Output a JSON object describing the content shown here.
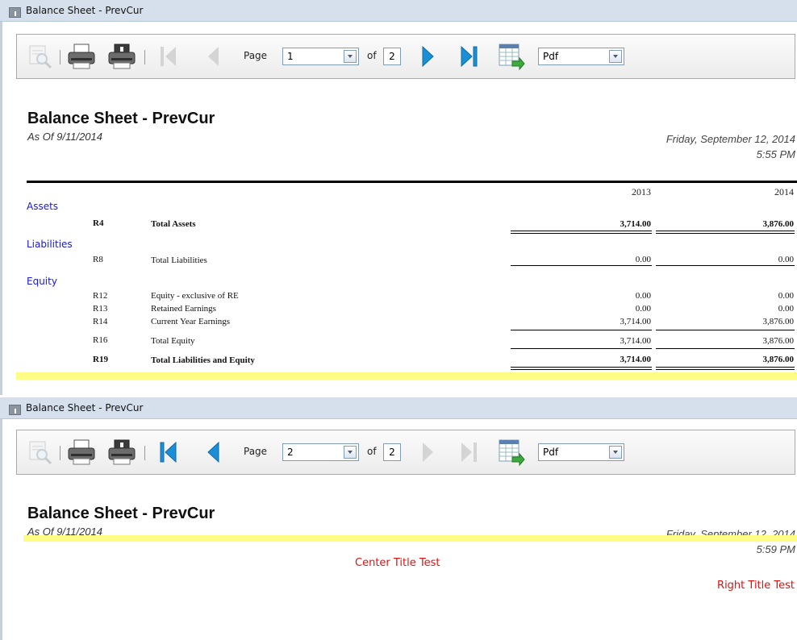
{
  "viewer1": {
    "window_title": "Balance Sheet - PrevCur",
    "toolbar": {
      "page_label": "Page",
      "page_value": "1",
      "of_label": "of",
      "total_pages": "2",
      "format_value": "Pdf"
    },
    "report": {
      "title": "Balance Sheet - PrevCur",
      "as_of": "As Of 9/11/2014",
      "date": "Friday, September 12, 2014",
      "time": "5:55 PM",
      "year_headers": [
        "2013",
        "2014"
      ],
      "sections": {
        "assets": "Assets",
        "liabilities": "Liabilities",
        "equity": "Equity"
      },
      "rows": [
        {
          "code": "R4",
          "label": "Total Assets",
          "v2013": "3,714.00",
          "v2014": "3,876.00",
          "bold": true
        },
        {
          "code": "R8",
          "label": "Total Liabilities",
          "v2013": "0.00",
          "v2014": "0.00",
          "bold": false
        },
        {
          "code": "R12",
          "label": "Equity - exclusive of RE",
          "v2013": "0.00",
          "v2014": "0.00",
          "bold": false
        },
        {
          "code": "R13",
          "label": "Retained Earnings",
          "v2013": "0.00",
          "v2014": "0.00",
          "bold": false
        },
        {
          "code": "R14",
          "label": "Current Year Earnings",
          "v2013": "3,714.00",
          "v2014": "3,876.00",
          "bold": false
        },
        {
          "code": "R16",
          "label": "Total Equity",
          "v2013": "3,714.00",
          "v2014": "3,876.00",
          "bold": false
        },
        {
          "code": "R19",
          "label": "Total Liabilities and Equity",
          "v2013": "3,714.00",
          "v2014": "3,876.00",
          "bold": true
        }
      ]
    }
  },
  "viewer2": {
    "window_title": "Balance Sheet - PrevCur",
    "toolbar": {
      "page_label": "Page",
      "page_value": "2",
      "of_label": "of",
      "total_pages": "2",
      "format_value": "Pdf"
    },
    "report": {
      "title": "Balance Sheet - PrevCur",
      "as_of": "As Of 9/11/2014",
      "date": "Friday, September 12, 2014",
      "time": "5:59 PM",
      "center_title": "Center Title Test",
      "right_title": "Right Title Test"
    }
  },
  "colors": {
    "title_bar": "#d5e0ec",
    "section_blue": "#1a1ad0",
    "highlight_yellow": "#fdfd85",
    "red_title": "#e01010",
    "nav_blue": "#1b8fd6"
  },
  "icons": [
    "zoom-icon",
    "print-icon",
    "print-server-icon",
    "first-page-icon",
    "previous-page-icon",
    "next-page-icon",
    "last-page-icon",
    "export-icon"
  ]
}
